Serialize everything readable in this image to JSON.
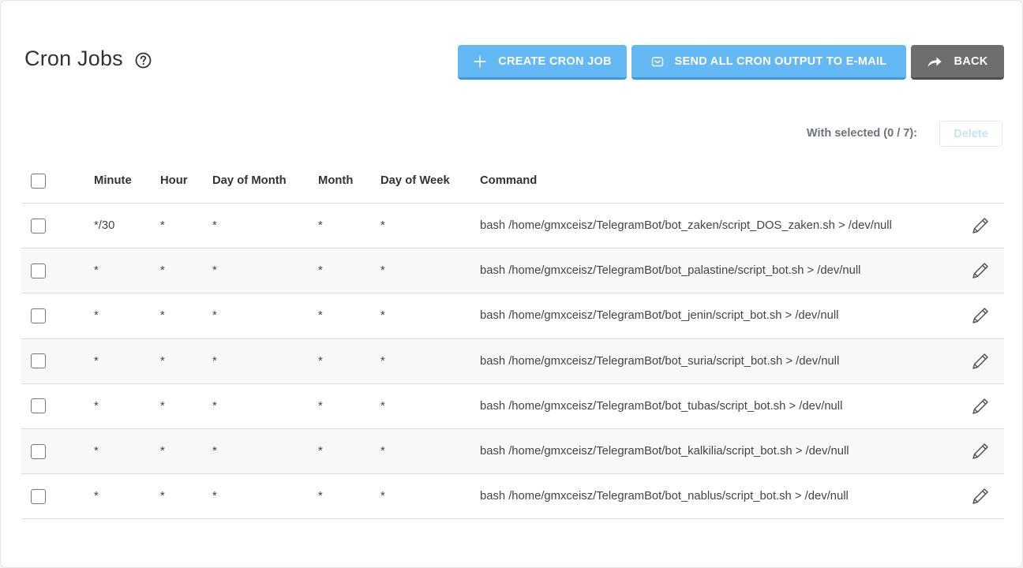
{
  "page": {
    "title": "Cron Jobs",
    "help_icon": "question-circle-icon"
  },
  "toolbar": {
    "create_label": "CREATE CRON JOB",
    "create_icon": "plus-icon",
    "email_label": "SEND ALL CRON OUTPUT TO E-MAIL",
    "email_icon": "envelope-icon",
    "back_label": "BACK",
    "back_icon": "share-arrow-icon"
  },
  "bulk": {
    "with_selected": "With selected (0 / 7):",
    "delete_label": "Delete"
  },
  "table": {
    "columns": [
      "Minute",
      "Hour",
      "Day of Month",
      "Month",
      "Day of Week",
      "Command"
    ],
    "rows": [
      {
        "minute": "*/30",
        "hour": "*",
        "dom": "*",
        "month": "*",
        "dow": "*",
        "command": "bash /home/gmxceisz/TelegramBot/bot_zaken/script_DOS_zaken.sh > /dev/null"
      },
      {
        "minute": "*",
        "hour": "*",
        "dom": "*",
        "month": "*",
        "dow": "*",
        "command": "bash /home/gmxceisz/TelegramBot/bot_palastine/script_bot.sh > /dev/null"
      },
      {
        "minute": "*",
        "hour": "*",
        "dom": "*",
        "month": "*",
        "dow": "*",
        "command": "bash /home/gmxceisz/TelegramBot/bot_jenin/script_bot.sh > /dev/null"
      },
      {
        "minute": "*",
        "hour": "*",
        "dom": "*",
        "month": "*",
        "dow": "*",
        "command": "bash /home/gmxceisz/TelegramBot/bot_suria/script_bot.sh > /dev/null"
      },
      {
        "minute": "*",
        "hour": "*",
        "dom": "*",
        "month": "*",
        "dow": "*",
        "command": "bash /home/gmxceisz/TelegramBot/bot_tubas/script_bot.sh > /dev/null"
      },
      {
        "minute": "*",
        "hour": "*",
        "dom": "*",
        "month": "*",
        "dow": "*",
        "command": "bash /home/gmxceisz/TelegramBot/bot_kalkilia/script_bot.sh > /dev/null"
      },
      {
        "minute": "*",
        "hour": "*",
        "dom": "*",
        "month": "*",
        "dow": "*",
        "command": "bash /home/gmxceisz/TelegramBot/bot_nablus/script_bot.sh > /dev/null"
      }
    ]
  },
  "colors": {
    "primary": "#64b9f4",
    "secondary": "#6e6e6e",
    "disabled_text": "#c5e2f7"
  }
}
